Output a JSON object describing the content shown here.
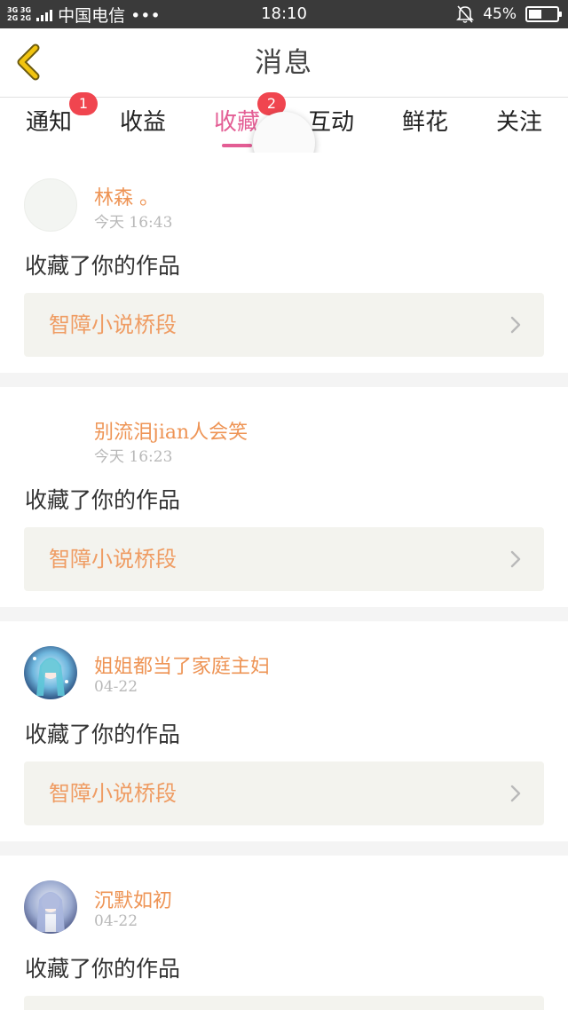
{
  "status_bar": {
    "net_top": "3G 3G",
    "net_bottom": "2G 2G",
    "carrier": "中国电信 •••",
    "time": "18:10",
    "battery": "45%",
    "battery_level": 0.45
  },
  "nav": {
    "title": "消息"
  },
  "tabs": [
    {
      "label": "通知",
      "badge": "1"
    },
    {
      "label": "收益",
      "badge": ""
    },
    {
      "label": "收藏",
      "badge": "2",
      "active": true
    },
    {
      "label": "互动",
      "badge": ""
    },
    {
      "label": "鲜花",
      "badge": ""
    },
    {
      "label": "关注",
      "badge": ""
    }
  ],
  "messages": [
    {
      "user": "林森 。",
      "time": "今天 16:43",
      "action": "收藏了你的作品",
      "work": "智障小说桥段",
      "avatar": "blank-avatar"
    },
    {
      "user": "别流泪jian人会笑",
      "time": "今天 16:23",
      "action": "收藏了你的作品",
      "work": "智障小说桥段",
      "avatar": "none"
    },
    {
      "user": "姐姐都当了家庭主妇",
      "time": "04-22",
      "action": "收藏了你的作品",
      "work": "智障小说桥段",
      "avatar": "anime-avatar"
    },
    {
      "user": "沉默如初",
      "time": "04-22",
      "action": "收藏了你的作品",
      "work": "",
      "avatar": "anime-avatar"
    }
  ],
  "colors": {
    "accent_pink": "#e35d94",
    "badge_red": "#f0454f",
    "username_orange": "#ee9455",
    "work_orange": "#ef9c63",
    "back_yellow": "#f1c40f"
  }
}
